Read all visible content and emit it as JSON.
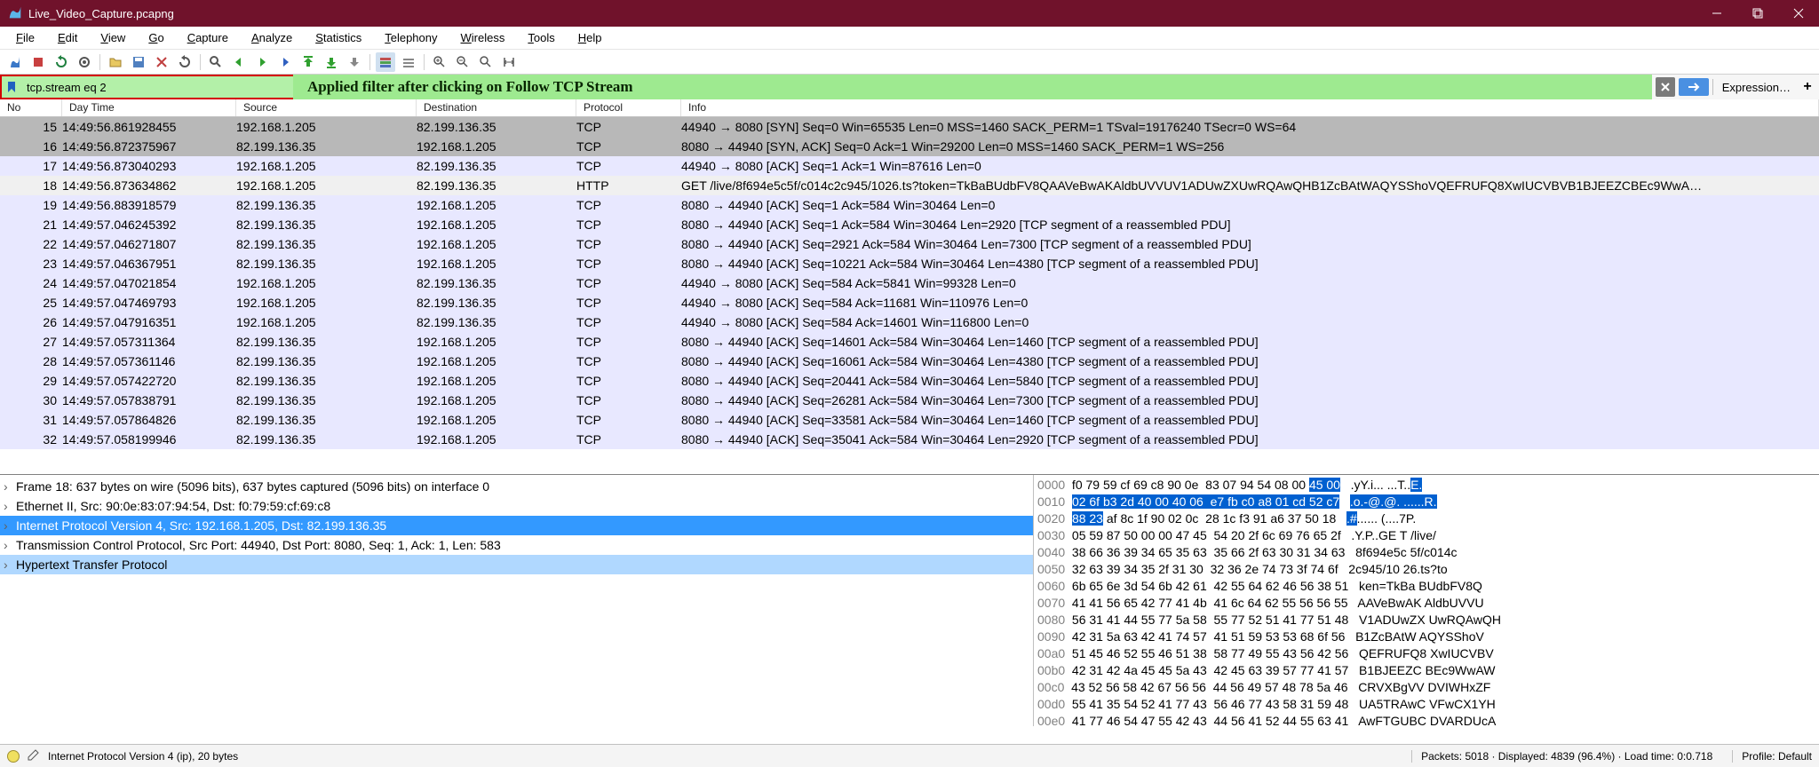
{
  "title": "Live_Video_Capture.pcapng",
  "menus": [
    "File",
    "Edit",
    "View",
    "Go",
    "Capture",
    "Analyze",
    "Statistics",
    "Telephony",
    "Wireless",
    "Tools",
    "Help"
  ],
  "filter_value": "tcp.stream eq 2",
  "banner": "Applied filter after clicking on Follow TCP Stream",
  "expression_label": "Expression…",
  "columns": {
    "no": "No",
    "day": "Day Time",
    "src": "Source",
    "dst": "Destination",
    "proto": "Protocol",
    "info": "Info"
  },
  "packets": [
    {
      "no": "15",
      "day": "14:49:56.861928455",
      "src": "192.168.1.205",
      "dst": "82.199.136.35",
      "proto": "TCP",
      "info": "44940 → 8080 [SYN] Seq=0 Win=65535 Len=0 MSS=1460 SACK_PERM=1 TSval=19176240 TSecr=0 WS=64",
      "cls": "syn"
    },
    {
      "no": "16",
      "day": "14:49:56.872375967",
      "src": "82.199.136.35",
      "dst": "192.168.1.205",
      "proto": "TCP",
      "info": "8080 → 44940 [SYN, ACK] Seq=0 Ack=1 Win=29200 Len=0 MSS=1460 SACK_PERM=1 WS=256",
      "cls": "syn"
    },
    {
      "no": "17",
      "day": "14:49:56.873040293",
      "src": "192.168.1.205",
      "dst": "82.199.136.35",
      "proto": "TCP",
      "info": "44940 → 8080 [ACK] Seq=1 Ack=1 Win=87616 Len=0",
      "cls": "ack"
    },
    {
      "no": "18",
      "day": "14:49:56.873634862",
      "src": "192.168.1.205",
      "dst": "82.199.136.35",
      "proto": "HTTP",
      "info": "GET /live/8f694e5c5f/c014c2c945/1026.ts?token=TkBaBUdbFV8QAAVeBwAKAldbUVVUV1ADUwZXUwRQAwQHB1ZcBAtWAQYSShoVQEFRUFQ8XwIUCVBVB1BJEEZCBEc9WwA",
      "cls": "sel",
      "trunc": true
    },
    {
      "no": "19",
      "day": "14:49:56.883918579",
      "src": "82.199.136.35",
      "dst": "192.168.1.205",
      "proto": "TCP",
      "info": "8080 → 44940 [ACK] Seq=1 Ack=584 Win=30464 Len=0",
      "cls": "ack"
    },
    {
      "no": "21",
      "day": "14:49:57.046245392",
      "src": "82.199.136.35",
      "dst": "192.168.1.205",
      "proto": "TCP",
      "info": "8080 → 44940 [ACK] Seq=1 Ack=584 Win=30464 Len=2920 [TCP segment of a reassembled PDU]",
      "cls": "ack"
    },
    {
      "no": "22",
      "day": "14:49:57.046271807",
      "src": "82.199.136.35",
      "dst": "192.168.1.205",
      "proto": "TCP",
      "info": "8080 → 44940 [ACK] Seq=2921 Ack=584 Win=30464 Len=7300 [TCP segment of a reassembled PDU]",
      "cls": "ack"
    },
    {
      "no": "23",
      "day": "14:49:57.046367951",
      "src": "82.199.136.35",
      "dst": "192.168.1.205",
      "proto": "TCP",
      "info": "8080 → 44940 [ACK] Seq=10221 Ack=584 Win=30464 Len=4380 [TCP segment of a reassembled PDU]",
      "cls": "ack"
    },
    {
      "no": "24",
      "day": "14:49:57.047021854",
      "src": "192.168.1.205",
      "dst": "82.199.136.35",
      "proto": "TCP",
      "info": "44940 → 8080 [ACK] Seq=584 Ack=5841 Win=99328 Len=0",
      "cls": "ack"
    },
    {
      "no": "25",
      "day": "14:49:57.047469793",
      "src": "192.168.1.205",
      "dst": "82.199.136.35",
      "proto": "TCP",
      "info": "44940 → 8080 [ACK] Seq=584 Ack=11681 Win=110976 Len=0",
      "cls": "ack"
    },
    {
      "no": "26",
      "day": "14:49:57.047916351",
      "src": "192.168.1.205",
      "dst": "82.199.136.35",
      "proto": "TCP",
      "info": "44940 → 8080 [ACK] Seq=584 Ack=14601 Win=116800 Len=0",
      "cls": "ack"
    },
    {
      "no": "27",
      "day": "14:49:57.057311364",
      "src": "82.199.136.35",
      "dst": "192.168.1.205",
      "proto": "TCP",
      "info": "8080 → 44940 [ACK] Seq=14601 Ack=584 Win=30464 Len=1460 [TCP segment of a reassembled PDU]",
      "cls": "ack"
    },
    {
      "no": "28",
      "day": "14:49:57.057361146",
      "src": "82.199.136.35",
      "dst": "192.168.1.205",
      "proto": "TCP",
      "info": "8080 → 44940 [ACK] Seq=16061 Ack=584 Win=30464 Len=4380 [TCP segment of a reassembled PDU]",
      "cls": "ack"
    },
    {
      "no": "29",
      "day": "14:49:57.057422720",
      "src": "82.199.136.35",
      "dst": "192.168.1.205",
      "proto": "TCP",
      "info": "8080 → 44940 [ACK] Seq=20441 Ack=584 Win=30464 Len=5840 [TCP segment of a reassembled PDU]",
      "cls": "ack"
    },
    {
      "no": "30",
      "day": "14:49:57.057838791",
      "src": "82.199.136.35",
      "dst": "192.168.1.205",
      "proto": "TCP",
      "info": "8080 → 44940 [ACK] Seq=26281 Ack=584 Win=30464 Len=7300 [TCP segment of a reassembled PDU]",
      "cls": "ack"
    },
    {
      "no": "31",
      "day": "14:49:57.057864826",
      "src": "82.199.136.35",
      "dst": "192.168.1.205",
      "proto": "TCP",
      "info": "8080 → 44940 [ACK] Seq=33581 Ack=584 Win=30464 Len=1460 [TCP segment of a reassembled PDU]",
      "cls": "ack"
    },
    {
      "no": "32",
      "day": "14:49:57.058199946",
      "src": "82.199.136.35",
      "dst": "192.168.1.205",
      "proto": "TCP",
      "info": "8080 → 44940 [ACK] Seq=35041 Ack=584 Win=30464 Len=2920 [TCP segment of a reassembled PDU]",
      "cls": "ack"
    }
  ],
  "details": [
    {
      "text": "Frame 18: 637 bytes on wire (5096 bits), 637 bytes captured (5096 bits) on interface 0",
      "cls": ""
    },
    {
      "text": "Ethernet II, Src: 90:0e:83:07:94:54, Dst: f0:79:59:cf:69:c8",
      "cls": ""
    },
    {
      "text": "Internet Protocol Version 4, Src: 192.168.1.205, Dst: 82.199.136.35",
      "cls": "sel"
    },
    {
      "text": "Transmission Control Protocol, Src Port: 44940, Dst Port: 8080, Seq: 1, Ack: 1, Len: 583",
      "cls": ""
    },
    {
      "text": "Hypertext Transfer Protocol",
      "cls": "hl"
    }
  ],
  "hex": [
    {
      "off": "0000",
      "b": "f0 79 59 cf 69 c8 90 0e  83 07 94 54 08 00 ",
      "hl": "45 00",
      "a": " .yY.i... ...T..",
      "ahl": "E."
    },
    {
      "off": "0010",
      "b": "",
      "hl": "02 6f b3 2d 40 00 40 06  e7 fb c0 a8 01 cd 52 c7",
      "a": " ",
      "ahl": ".o.-@.@. ......R."
    },
    {
      "off": "0020",
      "b": "",
      "hl": "88 23",
      "b2": " af 8c 1f 90 02 0c  28 1c f3 91 a6 37 50 18",
      "a": " ",
      "ahl": ".#",
      "a2": "...... (....7P."
    },
    {
      "off": "0030",
      "b": "05 59 87 50 00 00 47 45  54 20 2f 6c 69 76 65 2f",
      "a": " .Y.P..GE T /live/"
    },
    {
      "off": "0040",
      "b": "38 66 36 39 34 65 35 63  35 66 2f 63 30 31 34 63",
      "a": " 8f694e5c 5f/c014c"
    },
    {
      "off": "0050",
      "b": "32 63 39 34 35 2f 31 30  32 36 2e 74 73 3f 74 6f",
      "a": " 2c945/10 26.ts?to"
    },
    {
      "off": "0060",
      "b": "6b 65 6e 3d 54 6b 42 61  42 55 64 62 46 56 38 51",
      "a": " ken=TkBa BUdbFV8Q"
    },
    {
      "off": "0070",
      "b": "41 41 56 65 42 77 41 4b  41 6c 64 62 55 56 56 55",
      "a": " AAVeBwAK AldbUVVU"
    },
    {
      "off": "0080",
      "b": "56 31 41 44 55 77 5a 58  55 77 52 51 41 77 51 48",
      "a": " V1ADUwZX UwRQAwQH"
    },
    {
      "off": "0090",
      "b": "42 31 5a 63 42 41 74 57  41 51 59 53 53 68 6f 56",
      "a": " B1ZcBAtW AQYSShoV"
    },
    {
      "off": "00a0",
      "b": "51 45 46 52 55 46 51 38  58 77 49 55 43 56 42 56",
      "a": " QEFRUFQ8 XwIUCVBV"
    },
    {
      "off": "00b0",
      "b": "42 31 42 4a 45 45 5a 43  42 45 63 39 57 77 41 57",
      "a": " B1BJEEZC BEc9WwAW"
    },
    {
      "off": "00c0",
      "b": "43 52 56 58 42 67 56 56  44 56 49 57 48 78 5a 46",
      "a": " CRVXBgVV DVIWHxZF"
    },
    {
      "off": "00d0",
      "b": "55 41 35 54 52 41 77 43  56 46 77 43 58 31 59 48",
      "a": " UA5TRAwC VFwCX1YH"
    },
    {
      "off": "00e0",
      "b": "41 77 46 54 47 55 42 43  44 56 41 52 44 55 63 41",
      "a": " AwFTGUBC DVARDUcA"
    }
  ],
  "status": {
    "main": "Internet Protocol Version 4 (ip), 20 bytes",
    "packets": "Packets: 5018 · Displayed: 4839 (96.4%) · Load time: 0:0.718",
    "profile": "Profile: Default"
  }
}
